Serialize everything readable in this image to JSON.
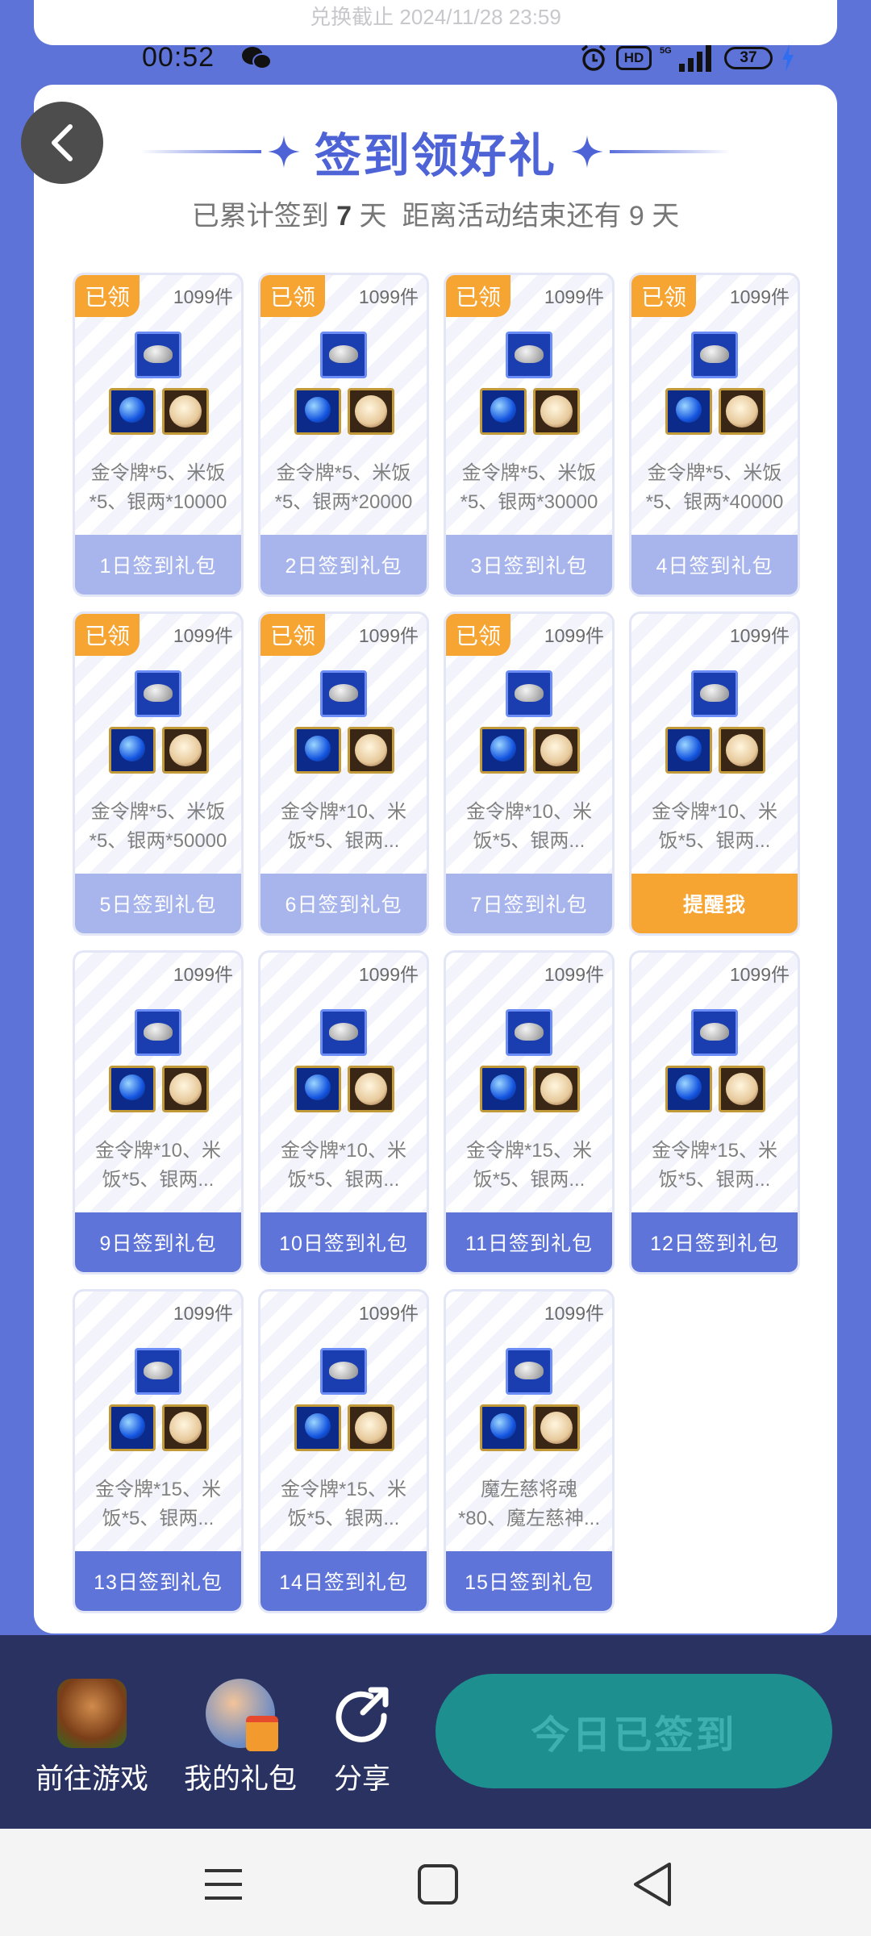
{
  "top_card": {
    "text": "兑换截止 2024/11/28 23:59"
  },
  "status_bar": {
    "time": "00:52",
    "hd": "HD",
    "battery": "37"
  },
  "page": {
    "title": "签到领好礼",
    "subtitle_prefix": "已累计签到",
    "days_signed": "7",
    "day_unit": "天",
    "subtitle_middle": "距离活动结束还有",
    "days_left": "9",
    "day_unit2": "天"
  },
  "claimed_badge": "已领",
  "cards": [
    {
      "count": "1099件",
      "desc": "金令牌*5、米饭\n*5、银两*10000",
      "cta": "1日签到礼包",
      "state": "done",
      "claimed": true
    },
    {
      "count": "1099件",
      "desc": "金令牌*5、米饭\n*5、银两*20000",
      "cta": "2日签到礼包",
      "state": "done",
      "claimed": true
    },
    {
      "count": "1099件",
      "desc": "金令牌*5、米饭\n*5、银两*30000",
      "cta": "3日签到礼包",
      "state": "done",
      "claimed": true
    },
    {
      "count": "1099件",
      "desc": "金令牌*5、米饭\n*5、银两*40000",
      "cta": "4日签到礼包",
      "state": "done",
      "claimed": true
    },
    {
      "count": "1099件",
      "desc": "金令牌*5、米饭\n*5、银两*50000",
      "cta": "5日签到礼包",
      "state": "done",
      "claimed": true
    },
    {
      "count": "1099件",
      "desc": "金令牌*10、米\n饭*5、银两...",
      "cta": "6日签到礼包",
      "state": "done",
      "claimed": true
    },
    {
      "count": "1099件",
      "desc": "金令牌*10、米\n饭*5、银两...",
      "cta": "7日签到礼包",
      "state": "done",
      "claimed": true
    },
    {
      "count": "1099件",
      "desc": "金令牌*10、米\n饭*5、银两...",
      "cta": "提醒我",
      "state": "active",
      "claimed": false
    },
    {
      "count": "1099件",
      "desc": "金令牌*10、米\n饭*5、银两...",
      "cta": "9日签到礼包",
      "state": "future",
      "claimed": false
    },
    {
      "count": "1099件",
      "desc": "金令牌*10、米\n饭*5、银两...",
      "cta": "10日签到礼包",
      "state": "future",
      "claimed": false
    },
    {
      "count": "1099件",
      "desc": "金令牌*15、米\n饭*5、银两...",
      "cta": "11日签到礼包",
      "state": "future",
      "claimed": false
    },
    {
      "count": "1099件",
      "desc": "金令牌*15、米\n饭*5、银两...",
      "cta": "12日签到礼包",
      "state": "future",
      "claimed": false
    },
    {
      "count": "1099件",
      "desc": "金令牌*15、米\n饭*5、银两...",
      "cta": "13日签到礼包",
      "state": "future",
      "claimed": false
    },
    {
      "count": "1099件",
      "desc": "金令牌*15、米\n饭*5、银两...",
      "cta": "14日签到礼包",
      "state": "future",
      "claimed": false
    },
    {
      "count": "1099件",
      "desc": "魔左慈将魂\n*80、魔左慈神...",
      "cta": "15日签到礼包",
      "state": "future",
      "claimed": false
    }
  ],
  "bottom_bar": {
    "game_label": "前往游戏",
    "gift_label": "我的礼包",
    "share_label": "分享",
    "signed_label": "今日已签到"
  },
  "colors": {
    "accent": "#5e73d8",
    "orange": "#f6a532",
    "teal": "#1e8f8f",
    "navy": "#293261"
  }
}
